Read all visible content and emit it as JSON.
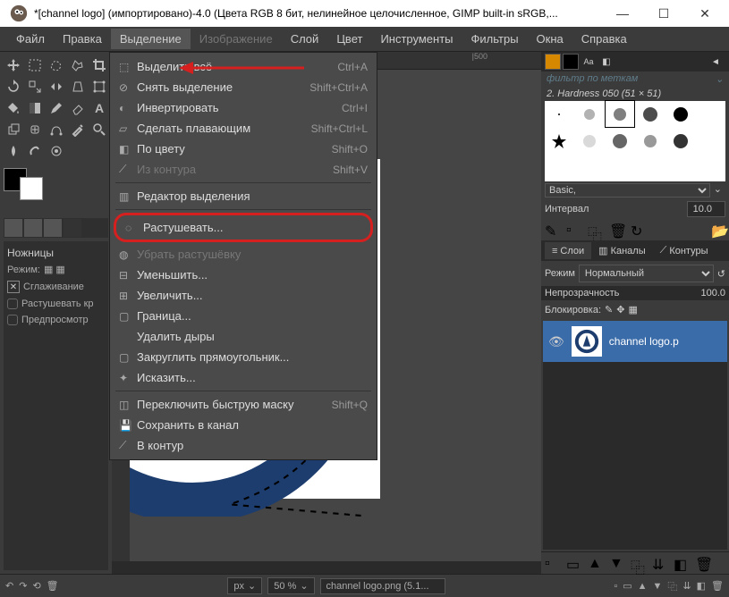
{
  "title": "*[channel logo] (импортировано)-4.0 (Цвета RGB 8 бит, нелинейное целочисленное, GIMP built-in sRGB,...",
  "menubar": [
    "Файл",
    "Правка",
    "Выделение",
    "Изображение",
    "Слой",
    "Цвет",
    "Инструменты",
    "Фильтры",
    "Окна",
    "Справка"
  ],
  "activeMenuIndex": 2,
  "dropdown": {
    "items": [
      {
        "label": "Выделить всё",
        "shortcut": "Ctrl+A"
      },
      {
        "label": "Снять выделение",
        "shortcut": "Shift+Ctrl+A"
      },
      {
        "label": "Инвертировать",
        "shortcut": "Ctrl+I"
      },
      {
        "label": "Сделать плавающим",
        "shortcut": "Shift+Ctrl+L"
      },
      {
        "label": "По цвету",
        "shortcut": "Shift+O"
      },
      {
        "label": "Из контура",
        "shortcut": "Shift+V",
        "disabled": true
      },
      {
        "sep": true
      },
      {
        "label": "Редактор выделения"
      },
      {
        "sep": true
      },
      {
        "label": "Растушевать...",
        "highlight": true
      },
      {
        "label": "Убрать растушёвку",
        "disabled": true
      },
      {
        "label": "Уменьшить..."
      },
      {
        "label": "Увеличить..."
      },
      {
        "label": "Граница..."
      },
      {
        "label": "Удалить дыры"
      },
      {
        "label": "Закруглить прямоугольник..."
      },
      {
        "label": "Исказить..."
      },
      {
        "sep": true
      },
      {
        "label": "Переключить быструю маску",
        "shortcut": "Shift+Q"
      },
      {
        "label": "Сохранить в канал"
      },
      {
        "label": "В контур"
      }
    ]
  },
  "toolOptions": {
    "title": "Ножницы",
    "mode": "Режим:",
    "antialias": "Сглаживание",
    "feather": "Растушевать кр",
    "preview": "Предпросмотр"
  },
  "rightPanel": {
    "filterLabel": "фильтр по меткам",
    "brushName": "2. Hardness 050 (51 × 51)",
    "preset": "Basic,",
    "intervalLabel": "Интервал",
    "intervalValue": "10.0",
    "layersTabs": [
      "Слои",
      "Каналы",
      "Контуры"
    ],
    "modeLabel": "Режим",
    "modeValue": "Нормальный",
    "opacityLabel": "Непрозрачность",
    "opacityValue": "100.0",
    "lockLabel": "Блокировка:",
    "layerName": "channel logo.p"
  },
  "ruler": {
    "marker": "|500"
  },
  "statusBar": {
    "unit": "px",
    "zoom": "50 %",
    "file": "channel logo.png (5.1..."
  }
}
